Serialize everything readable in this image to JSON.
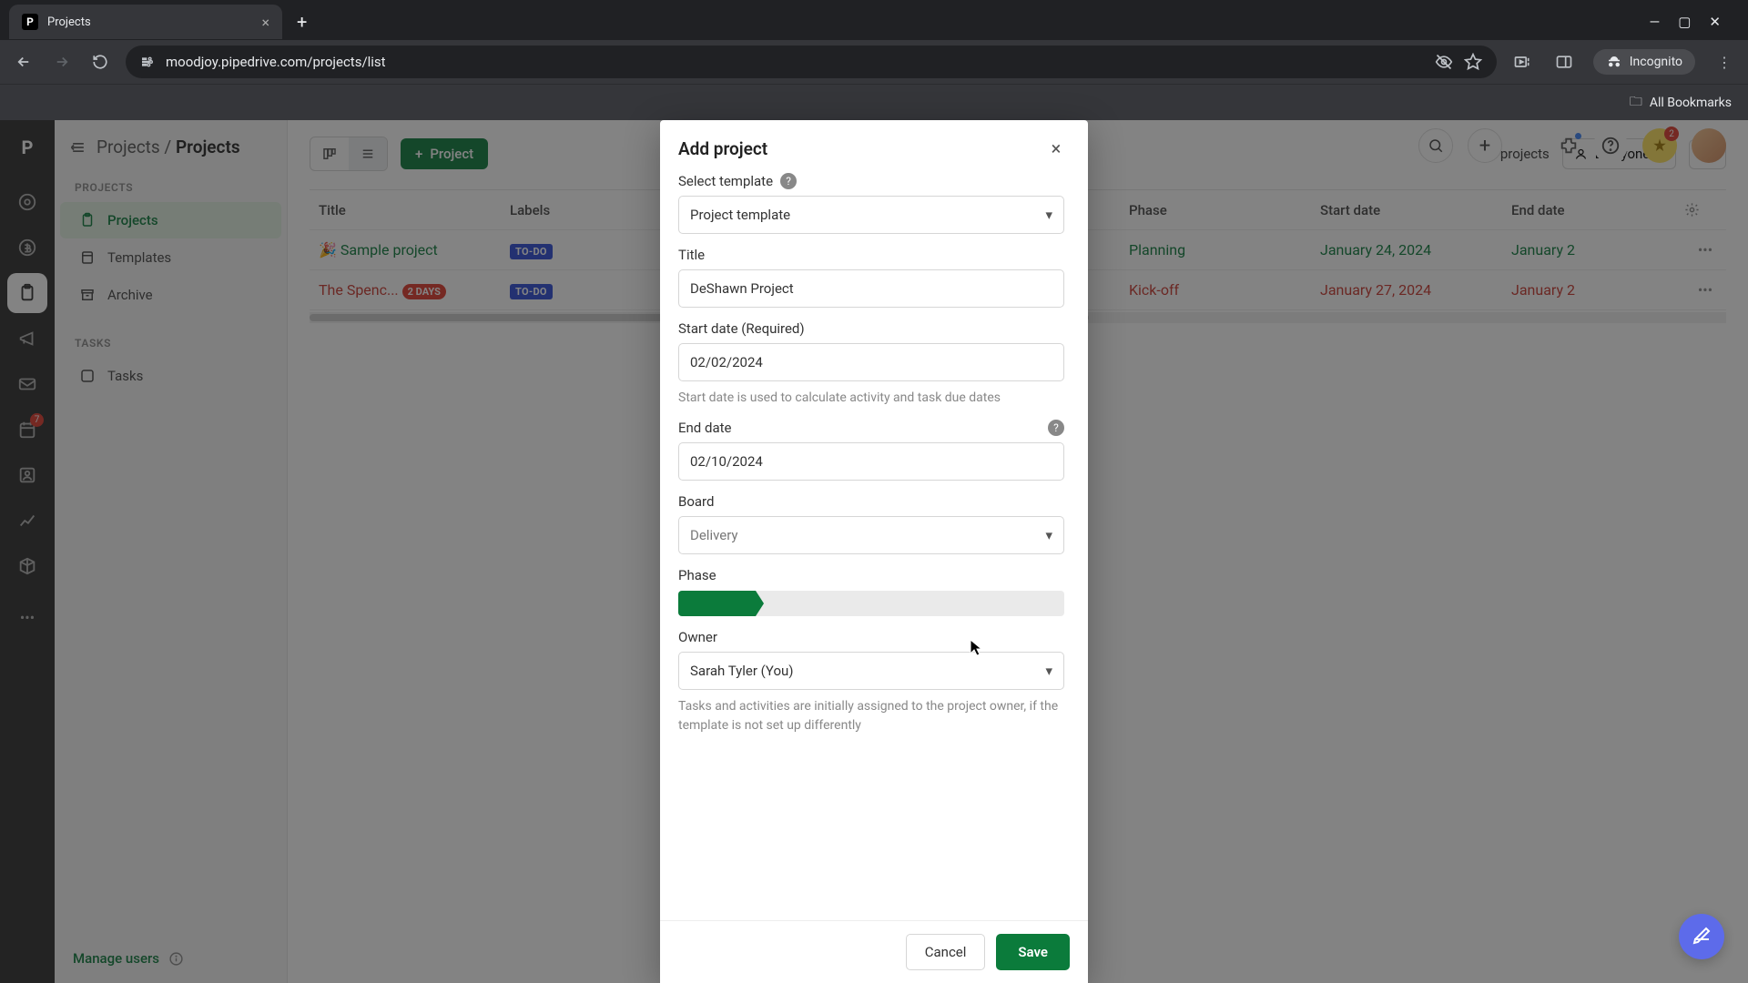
{
  "browser": {
    "tab_title": "Projects",
    "url": "moodjoy.pipedrive.com/projects/list",
    "incognito_label": "Incognito",
    "all_bookmarks": "All Bookmarks"
  },
  "rail": {
    "badge_mail": "7"
  },
  "sidebar": {
    "breadcrumb_root": "Projects",
    "breadcrumb_leaf": "Projects",
    "section_projects": "PROJECTS",
    "section_tasks": "TASKS",
    "items": [
      "Projects",
      "Templates",
      "Archive"
    ],
    "tasks_items": [
      "Tasks"
    ],
    "manage_users": "Manage users"
  },
  "main": {
    "btn_project": "Project",
    "count": "2 projects",
    "everyone": "Everyone",
    "columns": [
      "Title",
      "Labels",
      "Phase",
      "Start date",
      "End date"
    ],
    "rows": [
      {
        "title": "Sample project",
        "emoji": "🎉",
        "labels": [
          "TO-DO"
        ],
        "days": "",
        "phase": "Planning",
        "start": "January 24, 2024",
        "end": "January 2",
        "link_class": ""
      },
      {
        "title": "The Spenc...",
        "emoji": "",
        "labels": [
          "TO-DO"
        ],
        "days": "2 DAYS",
        "phase": "Kick-off",
        "start": "January 27, 2024",
        "end": "January 2",
        "link_class": "red"
      }
    ]
  },
  "topbar": {
    "alert_count": "2"
  },
  "modal": {
    "title": "Add project",
    "select_template_label": "Select template",
    "template_value": "Project template",
    "title_label": "Title",
    "title_value": "DeShawn Project",
    "start_label": "Start date (Required)",
    "start_value": "02/02/2024",
    "start_hint": "Start date is used to calculate activity and task due dates",
    "end_label": "End date",
    "end_value": "02/10/2024",
    "board_label": "Board",
    "board_value": "Delivery",
    "phase_label": "Phase",
    "owner_label": "Owner",
    "owner_value": "Sarah Tyler (You)",
    "owner_hint": "Tasks and activities are initially assigned to the project owner, if the template is not set up differently",
    "cancel": "Cancel",
    "save": "Save"
  }
}
